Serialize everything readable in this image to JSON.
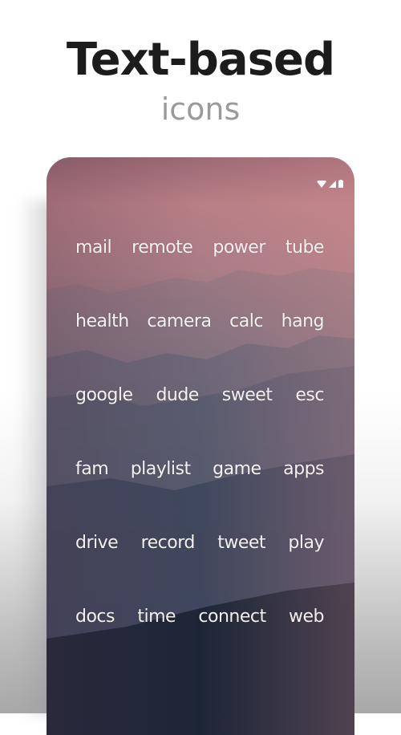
{
  "promo": {
    "headline": "Text-based",
    "subheadline": "icons"
  },
  "status_bar": {
    "icons": [
      "wifi-icon",
      "cellular-signal-icon",
      "battery-icon"
    ]
  },
  "apps": [
    [
      "mail",
      "remote",
      "power",
      "tube"
    ],
    [
      "health",
      "camera",
      "calc",
      "hang"
    ],
    [
      "google",
      "dude",
      "sweet",
      "esc"
    ],
    [
      "fam",
      "playlist",
      "game",
      "apps"
    ],
    [
      "drive",
      "record",
      "tweet",
      "play"
    ],
    [
      "docs",
      "time",
      "connect",
      "web"
    ]
  ],
  "colors": {
    "headline": "#1c1c1c",
    "subheadline": "#9a9a9a",
    "sky_top": "#b87f86",
    "sky_bottom": "#0f1828",
    "label": "#f4f0f0"
  }
}
